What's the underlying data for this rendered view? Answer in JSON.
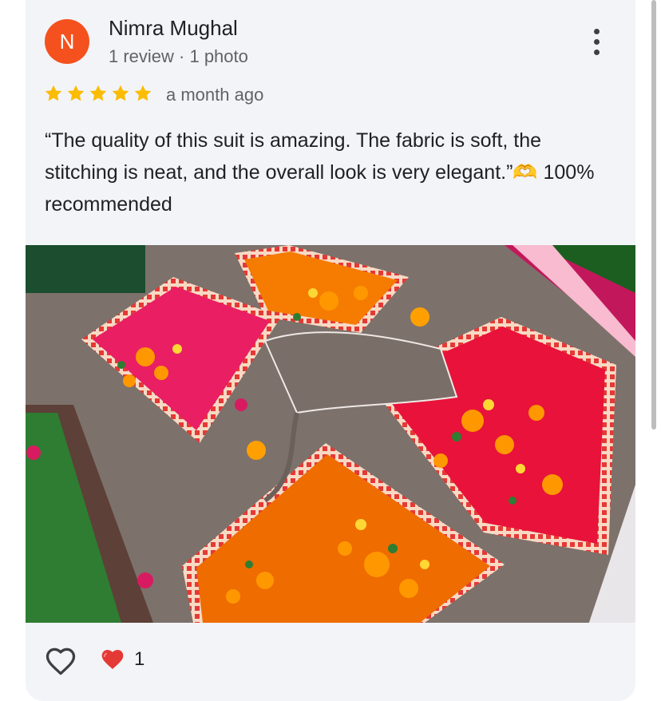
{
  "review": {
    "author_initial": "N",
    "author_name": "Nimra Mughal",
    "author_meta": "1 review · 1 photo",
    "rating": 5,
    "time_ago": "a month ago",
    "text": "“The quality of this suit is amazing. The fabric is soft, the stitching is neat, and the overall look is very elegant.”🫶 100% recommended"
  },
  "reactions": {
    "heart_count": "1"
  },
  "icons": {
    "menu": "more-vert-icon",
    "like": "heart-outline-icon",
    "reaction": "red-heart-emoji"
  },
  "colors": {
    "avatar": "#f4511e",
    "star": "#fbbc04",
    "card_bg": "#f3f4f7"
  }
}
